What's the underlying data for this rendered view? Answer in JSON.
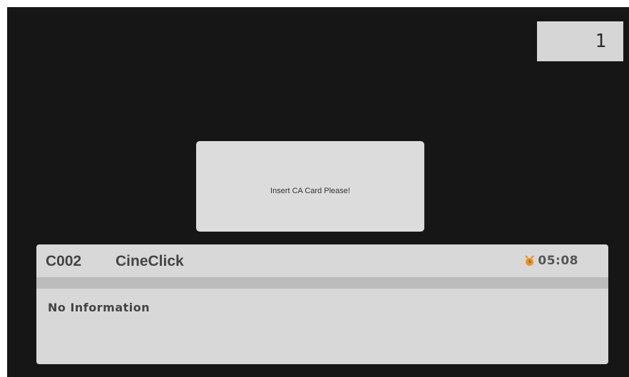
{
  "channel_number": "1",
  "popup": {
    "message": "Insert CA Card Please!"
  },
  "info_bar": {
    "channel_id": "C002",
    "channel_name": "CineClick",
    "time": "05:08",
    "timer_icon": "alarm-clock-icon",
    "program_info": "No Information"
  },
  "colors": {
    "screen_background": "#161616",
    "panel_background": "#d8d8d8",
    "separator": "#bcbcbc",
    "icon_accent": "#e88a1a"
  }
}
